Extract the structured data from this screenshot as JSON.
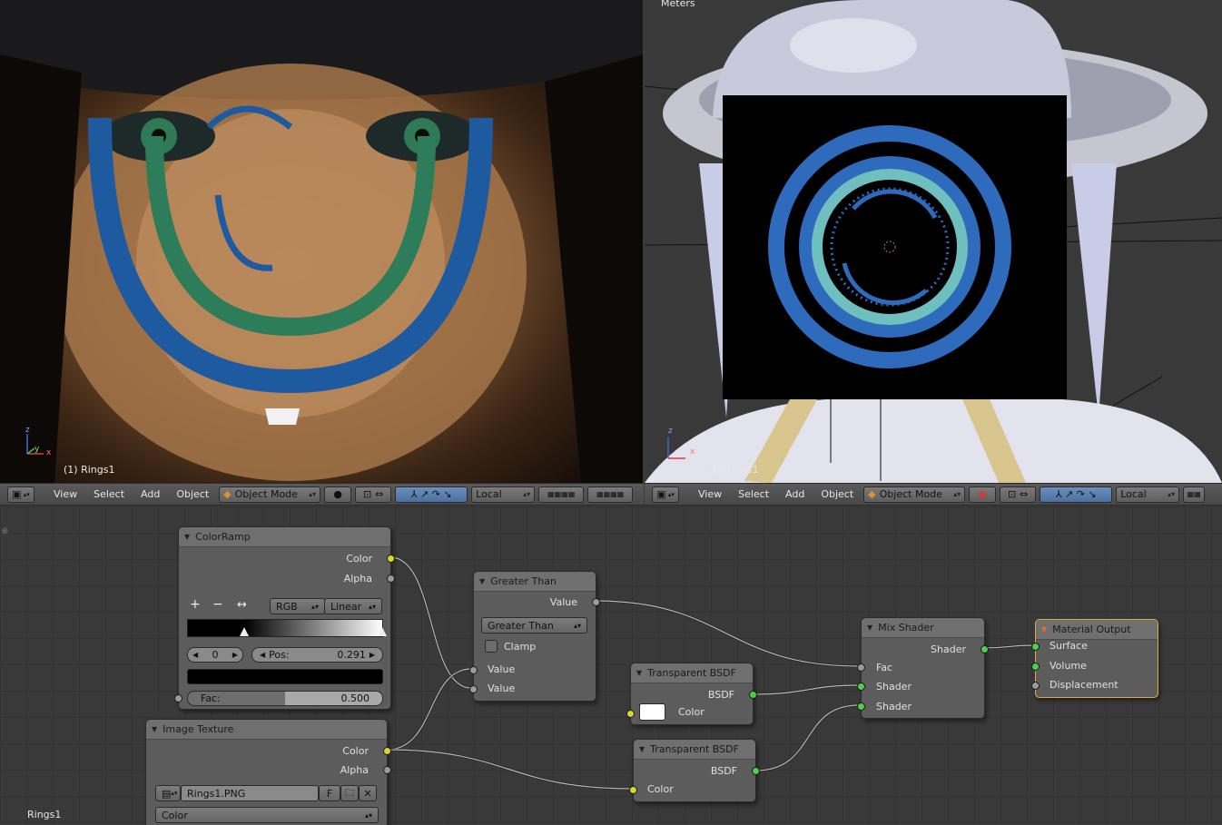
{
  "render_view": {
    "object_label": "(1) Rings1",
    "axes": {
      "z": "z",
      "y": "y",
      "x": "x"
    }
  },
  "view3d": {
    "units": "Meters",
    "object_label": "(1) Rings1",
    "axes": {
      "z": "z",
      "x": "x"
    }
  },
  "header_left": {
    "menus": [
      "View",
      "Select",
      "Add",
      "Object"
    ],
    "mode": "Object Mode",
    "orientation": "Local"
  },
  "header_right": {
    "menus": [
      "View",
      "Select",
      "Add",
      "Object"
    ],
    "mode": "Object Mode",
    "orientation": "Local"
  },
  "node_editor": {
    "material_name": "Rings1",
    "colorramp": {
      "title": "ColorRamp",
      "outputs": [
        "Color",
        "Alpha"
      ],
      "add": "+",
      "remove": "−",
      "flip": "↔",
      "color_mode": "RGB",
      "interpolation": "Linear",
      "stop_index": "0",
      "pos_label": "Pos:",
      "pos_value": "0.291",
      "fac_label": "Fac:",
      "fac_value": "0.500",
      "fac_fraction": 0.5,
      "ramp_stop": 0.291
    },
    "image_texture": {
      "title": "Image Texture",
      "outputs": [
        "Color",
        "Alpha"
      ],
      "image": "Rings1.PNG",
      "fake_user": "F",
      "color_space": "Color"
    },
    "greater_than": {
      "title": "Greater Than",
      "output": "Value",
      "operation": "Greater Than",
      "clamp": "Clamp",
      "inputs": [
        "Value",
        "Value"
      ]
    },
    "transparent1": {
      "title": "Transparent BSDF",
      "output": "BSDF",
      "input": "Color",
      "swatch": "#ffffff"
    },
    "transparent2": {
      "title": "Transparent BSDF",
      "output": "BSDF",
      "input": "Color"
    },
    "mix_shader": {
      "title": "Mix Shader",
      "output": "Shader",
      "inputs": [
        "Fac",
        "Shader",
        "Shader"
      ]
    },
    "material_output": {
      "title": "Material Output",
      "inputs": [
        "Surface",
        "Volume",
        "Displacement"
      ]
    }
  }
}
